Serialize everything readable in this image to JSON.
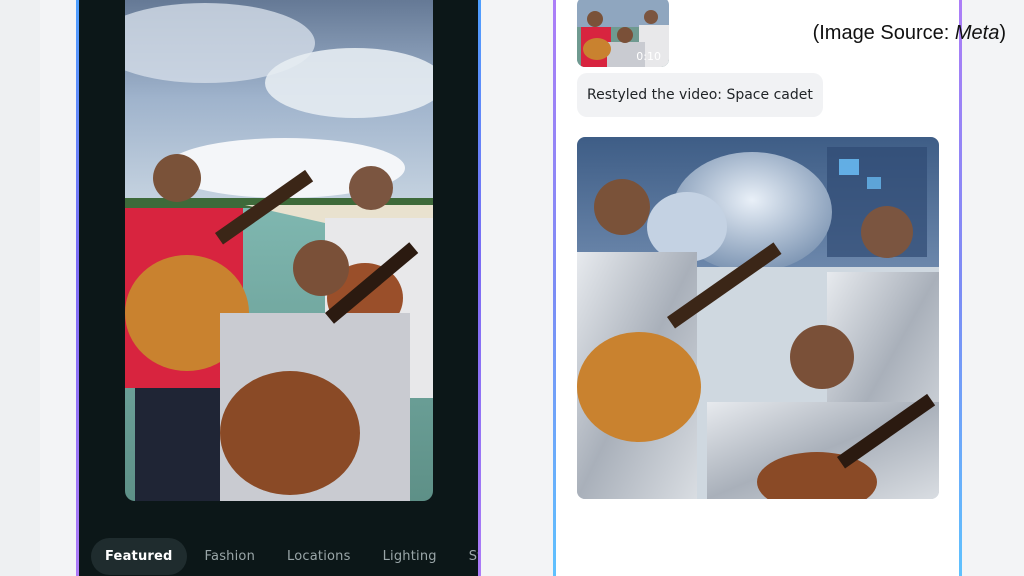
{
  "source_credit": {
    "prefix": "(Image Source: ",
    "name": "Meta",
    "suffix": ")"
  },
  "editor": {
    "filters": [
      {
        "label": "Featured",
        "active": true
      },
      {
        "label": "Fashion",
        "active": false
      },
      {
        "label": "Locations",
        "active": false
      },
      {
        "label": "Lighting",
        "active": false
      },
      {
        "label": "Sty",
        "active": false
      }
    ]
  },
  "chat": {
    "thumbnail_duration": "0:10",
    "message": "Restyled the video: Space cadet"
  }
}
